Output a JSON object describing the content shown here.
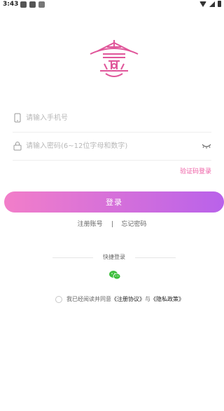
{
  "status_bar": {
    "time": "3:43"
  },
  "login": {
    "phone_placeholder": "请输入手机号",
    "password_placeholder": "请输入密码(6~12位字母和数字)",
    "code_login": "验证码登录",
    "submit": "登录",
    "register": "注册账号",
    "forgot": "忘记密码",
    "quick_login": "快捷登录"
  },
  "agreement": {
    "prefix": "我已经阅读并同意",
    "terms": "《注册协议》",
    "and": "与",
    "privacy": "《隐私政策》"
  },
  "colors": {
    "accent": "#ee5fa5",
    "gradient_start": "#f27ec9",
    "gradient_end": "#b962ea",
    "wechat": "#3fbf3f"
  },
  "icons": [
    "phone-icon",
    "lock-icon",
    "eye-closed-icon",
    "wechat-icon",
    "app-logo"
  ]
}
